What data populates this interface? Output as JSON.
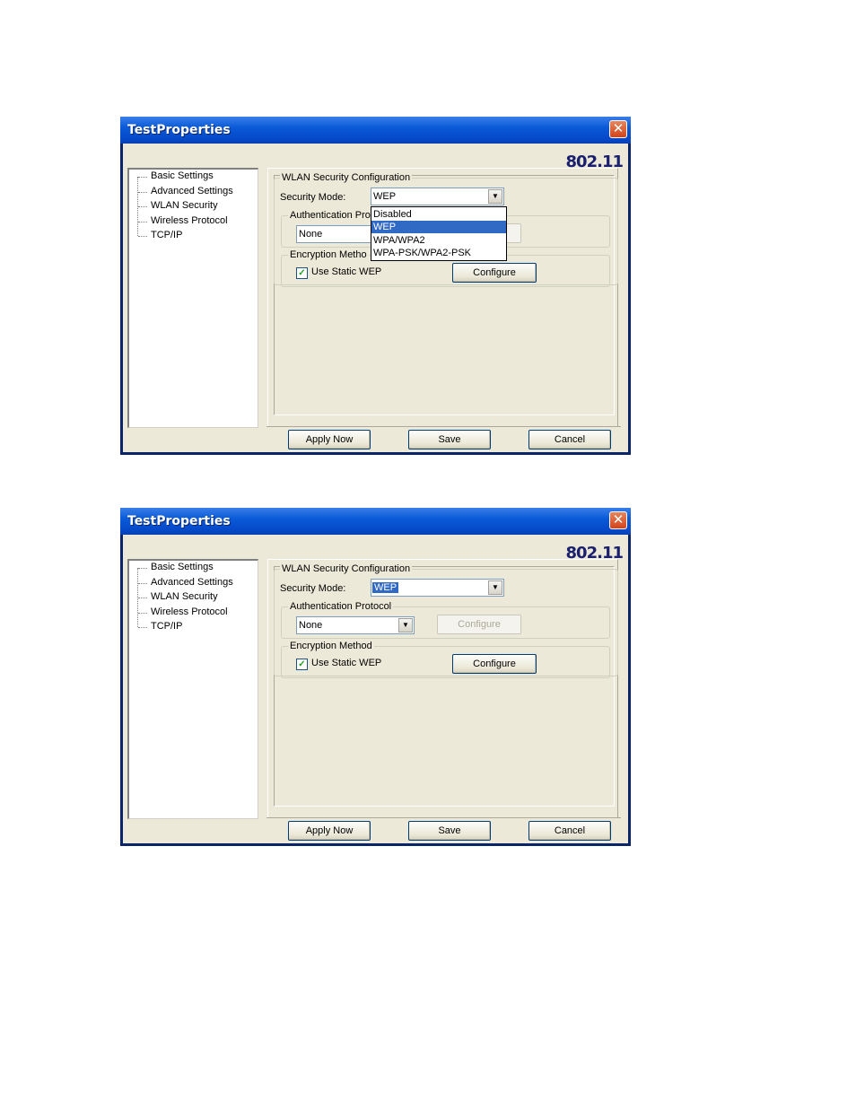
{
  "windows": [
    {
      "title": "TestProperties",
      "logo": "802.11",
      "tree_items": [
        "Basic Settings",
        "Advanced Settings",
        "WLAN Security",
        "Wireless Protocol",
        "TCP/IP"
      ],
      "group_title": "WLAN Security Configuration",
      "security_mode_label": "Security Mode:",
      "security_mode_value": "WEP",
      "auth_group_title": "Authentication Pro",
      "auth_value": "None",
      "encryption_group_title": "Encryption Metho",
      "use_static_wep_label": "Use Static WEP",
      "configure_label": "Configure",
      "dropdown_options": [
        "Disabled",
        "WEP",
        "WPA/WPA2",
        "WPA-PSK/WPA2-PSK"
      ],
      "dropdown_selected": "WEP",
      "apply_label": "Apply Now",
      "save_label": "Save",
      "cancel_label": "Cancel"
    },
    {
      "title": "TestProperties",
      "logo": "802.11",
      "tree_items": [
        "Basic Settings",
        "Advanced Settings",
        "WLAN Security",
        "Wireless Protocol",
        "TCP/IP"
      ],
      "group_title": "WLAN Security Configuration",
      "security_mode_label": "Security Mode:",
      "security_mode_value": "WEP",
      "auth_group_title": "Authentication Protocol",
      "auth_value": "None",
      "auth_configure_label": "Configure",
      "encryption_group_title": "Encryption Method",
      "use_static_wep_label": "Use Static WEP",
      "configure_label": "Configure",
      "apply_label": "Apply Now",
      "save_label": "Save",
      "cancel_label": "Cancel"
    }
  ],
  "icons": {
    "close": "close-x-icon",
    "combo_arrow": "chevron-down-icon",
    "checkbox": "checkmark-icon"
  },
  "colors": {
    "title_bar": "#0a5ad8",
    "close_button": "#d3431a",
    "selection": "#316ac5",
    "dialog_bg": "#ece9d8",
    "logo": "#1a1f6e"
  }
}
